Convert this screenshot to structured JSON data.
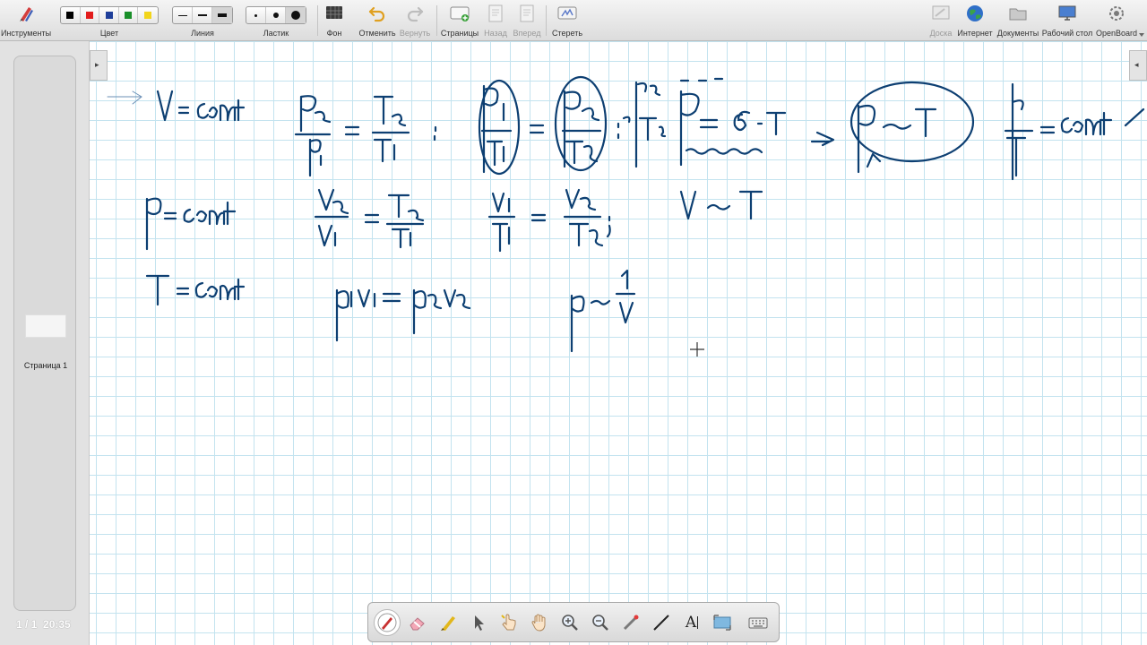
{
  "toolbar": {
    "tools_label": "Инструменты",
    "color_label": "Цвет",
    "line_label": "Линия",
    "eraser_label": "Ластик",
    "background_label": "Фон",
    "undo_label": "Отменить",
    "redo_label": "Вернуть",
    "pages_label": "Страницы",
    "back_label": "Назад",
    "forward_label": "Вперед",
    "clear_label": "Стереть",
    "board_label": "Доска",
    "internet_label": "Интернет",
    "documents_label": "Документы",
    "desktop_label": "Рабочий стол",
    "openboard_label": "OpenBoard"
  },
  "colors": {
    "black": "#000000",
    "red": "#e21c1c",
    "blue": "#1f3f9a",
    "green": "#1a8f2a",
    "yellow": "#f2d51b",
    "ink": "#0d3f72"
  },
  "pages_panel": {
    "thumbnail_label": "Страница 1",
    "page_counter": "1 / 1",
    "time": "20:35"
  },
  "palette": {
    "tools": [
      "pen-icon",
      "eraser-icon",
      "highlighter-icon",
      "selector-icon",
      "interactor-icon",
      "hand-icon",
      "zoom-in-icon",
      "zoom-out-icon",
      "laser-pointer-icon",
      "line-icon",
      "text-icon",
      "capture-icon",
      "keyboard-icon"
    ],
    "text_tool_glyph": "A"
  }
}
